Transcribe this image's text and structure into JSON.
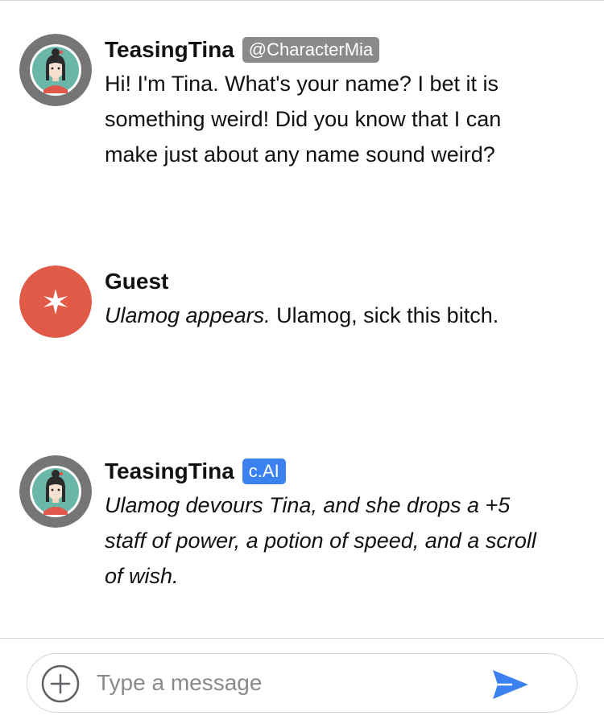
{
  "messages": [
    {
      "author": "TeasingTina",
      "badge": "@CharacterMia",
      "text": "Hi! I'm Tina. What's your name? I bet it is something weird! Did you know that I can make just about any name sound weird?"
    },
    {
      "author": "Guest",
      "text_italic": "Ulamog appears.",
      "text_rest": " Ulamog, sick this bitch."
    },
    {
      "author": "TeasingTina",
      "badge": "c.AI",
      "text_italic": "Ulamog devours Tina, and she drops a +5 staff of power, a potion of speed, and a scroll of wish."
    }
  ],
  "composer": {
    "placeholder": "Type a message"
  },
  "icons": {
    "add": "plus-circle-icon",
    "send": "send-arrow-icon",
    "guest_avatar": "sparkle-icon"
  },
  "colors": {
    "guest_avatar": "#e05a47",
    "tina_avatar_ring": "#757575",
    "tina_avatar_bg": "#6ab7aa",
    "badge_character": "#8a8a8a",
    "badge_cai": "#3b82f0",
    "send": "#3b82f0"
  }
}
